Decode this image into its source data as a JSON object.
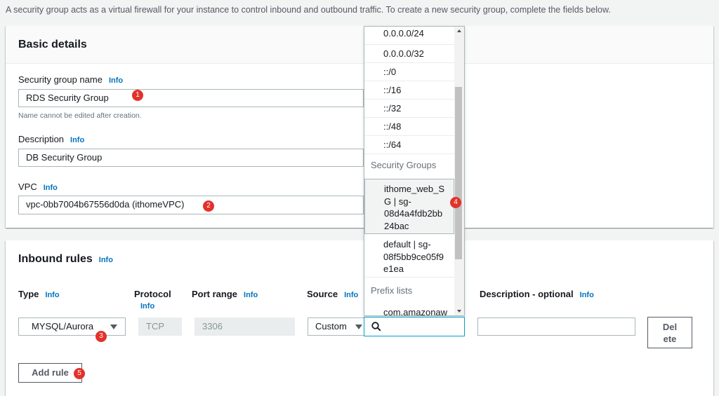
{
  "intro_text": "A security group acts as a virtual firewall for your instance to control inbound and outbound traffic. To create a new security group, complete the fields below.",
  "info_label": "Info",
  "basic": {
    "title": "Basic details",
    "name_label": "Security group name",
    "name_value": "RDS Security Group",
    "name_hint": "Name cannot be edited after creation.",
    "desc_label": "Description",
    "desc_value": "DB Security Group",
    "vpc_label": "VPC",
    "vpc_value": "vpc-0bb7004b67556d0da (ithomeVPC)"
  },
  "inbound": {
    "title": "Inbound rules",
    "col_type": "Type",
    "col_protocol": "Protocol",
    "col_port": "Port range",
    "col_source": "Source",
    "col_desc": "Description - optional",
    "type_value": "MYSQL/Aurora",
    "protocol_value": "TCP",
    "port_value": "3306",
    "source_value": "Custom",
    "desc_value": "",
    "delete_line1": "Del",
    "delete_line2": "ete",
    "add_rule": "Add rule"
  },
  "dropdown": {
    "cidrs": [
      "0.0.0.0/24",
      "0.0.0.0/32",
      "::/0",
      "::/16",
      "::/32",
      "::/48",
      "::/64"
    ],
    "group_security": "Security Groups",
    "sg1": [
      "ithome_web_S",
      "G | sg-",
      "08d4a4fdb2bb",
      "24bac"
    ],
    "sg2": [
      "default | sg-",
      "08f5bb9ce05f9",
      "e1ea"
    ],
    "group_prefix": "Prefix lists",
    "prefix1": "com.amazonaw"
  },
  "badges": [
    "1",
    "2",
    "3",
    "4",
    "5"
  ],
  "colors": {
    "accent": "#0073bb",
    "badge": "#e3322b",
    "focus": "#00a1c9"
  }
}
